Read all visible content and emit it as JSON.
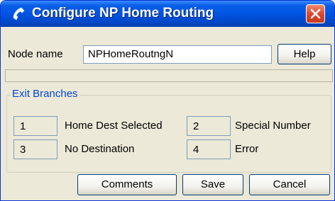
{
  "window": {
    "title": "Configure NP Home Routing",
    "accent": "#0054e3"
  },
  "node": {
    "label": "Node name",
    "value": "NPHomeRoutngN",
    "help_label": "Help"
  },
  "exit_branches": {
    "title": "Exit Branches",
    "items": [
      {
        "number": "1",
        "label": "Home Dest Selected"
      },
      {
        "number": "2",
        "label": "Special Number"
      },
      {
        "number": "3",
        "label": "No Destination"
      },
      {
        "number": "4",
        "label": "Error"
      }
    ]
  },
  "buttons": {
    "comments": "Comments",
    "save": "Save",
    "cancel": "Cancel"
  }
}
